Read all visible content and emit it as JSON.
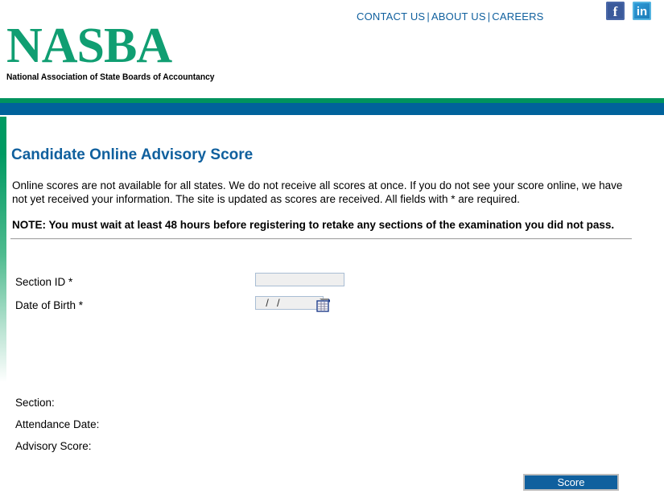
{
  "header": {
    "utility_nav": [
      {
        "label": "CONTACT US",
        "name": "contact-us-link"
      },
      {
        "label": "ABOUT US",
        "name": "about-us-link"
      },
      {
        "label": "CAREERS",
        "name": "careers-link"
      }
    ],
    "separator": "|",
    "social": {
      "facebook": {
        "glyph": "f",
        "name": "facebook-icon",
        "color": "#3B5A9B"
      },
      "linkedin": {
        "glyph": "in",
        "name": "linkedin-icon",
        "color": "#2083BF"
      }
    },
    "logo": {
      "wordmark": "NASBA",
      "tagline": "National Association of State Boards of Accountancy",
      "color": "#109E72"
    }
  },
  "bands": {
    "green_color": "#00935E",
    "blue_color": "#00629B",
    "left_stripe_color": "#009A62"
  },
  "main": {
    "title": "Candidate Online Advisory Score",
    "title_color": "#10609E",
    "intro": "Online scores are not available for all states. We do not receive all scores at once. If you do not see your score online, we have not yet received your information. The site is updated as scores are received. All fields with * are required.",
    "note": "NOTE: You must wait at least 48 hours before registering to retake any sections of the examination you did not pass."
  },
  "form": {
    "fields": [
      {
        "label": "Section ID *",
        "value": "",
        "placeholder": "",
        "name": "section-id"
      },
      {
        "label": "Date of Birth *",
        "value": "  /  /    ",
        "placeholder": "  /  /    ",
        "name": "date-of-birth"
      }
    ],
    "calendar_icon": "calendar-icon"
  },
  "results": [
    {
      "label": "Section:",
      "value": ""
    },
    {
      "label": "Attendance Date:",
      "value": ""
    },
    {
      "label": "Advisory Score:",
      "value": ""
    }
  ],
  "actions": {
    "score_label": "Score",
    "score_color": "#10609E"
  }
}
